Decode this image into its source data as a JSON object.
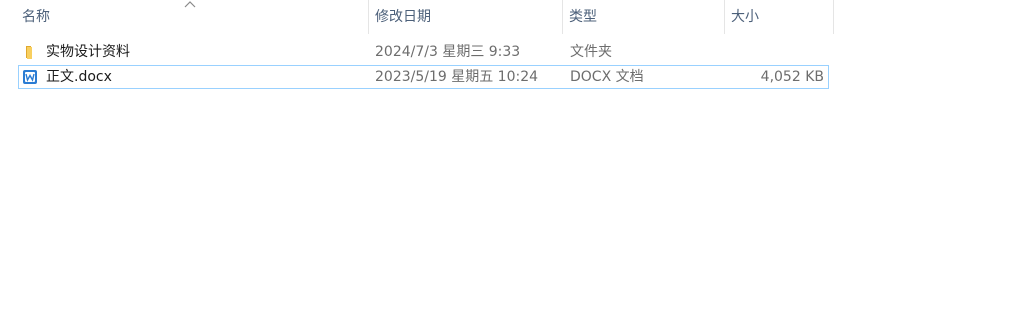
{
  "columns": {
    "name": "名称",
    "modified": "修改日期",
    "type": "类型",
    "size": "大小"
  },
  "sort": {
    "column": "name",
    "icon": "sort-ascending-icon"
  },
  "files": [
    {
      "name": "实物设计资料",
      "modified": "2024/7/3 星期三 9:33",
      "type": "文件夹",
      "size": "",
      "icon": "folder-icon",
      "selected": false
    },
    {
      "name": "正文.docx",
      "modified": "2023/5/19 星期五 10:24",
      "type": "DOCX 文档",
      "size": "4,052 KB",
      "icon": "wps-writer-document-icon",
      "selected": true
    }
  ],
  "colors": {
    "header_text": "#4c607a",
    "row_text": "#1a1a1a",
    "muted_text": "#6d6d6d",
    "selection_border": "#99d1ff",
    "folder": "#f8cf5f",
    "doc_icon": "#2b7cd3"
  }
}
